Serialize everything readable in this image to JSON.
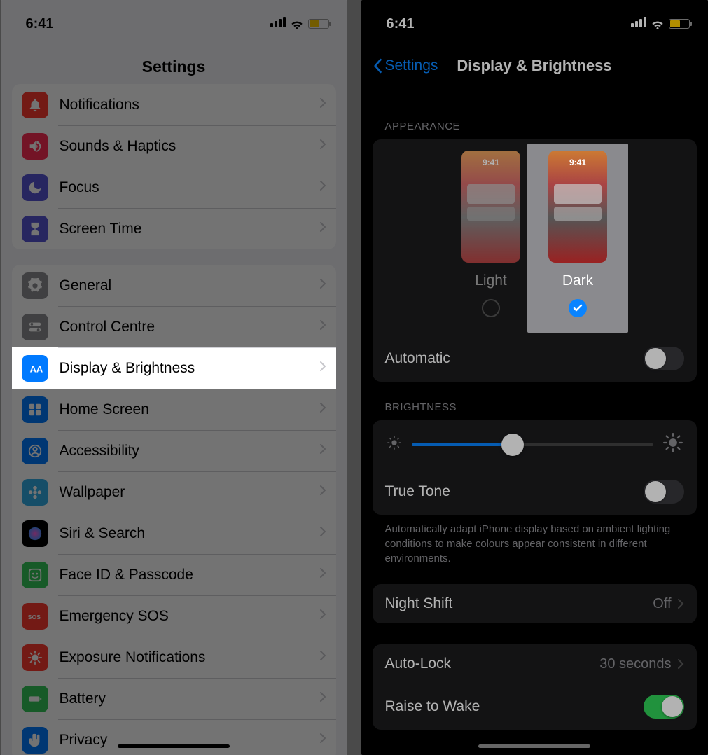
{
  "statusbar": {
    "time": "6:41"
  },
  "left": {
    "title": "Settings",
    "group1": [
      {
        "label": "Notifications",
        "icon": "bell",
        "color": "ic-red"
      },
      {
        "label": "Sounds & Haptics",
        "icon": "speaker",
        "color": "ic-pink"
      },
      {
        "label": "Focus",
        "icon": "moon",
        "color": "ic-indigo"
      },
      {
        "label": "Screen Time",
        "icon": "hourglass",
        "color": "ic-indigo"
      }
    ],
    "group2": [
      {
        "label": "General",
        "icon": "gear",
        "color": "ic-gray"
      },
      {
        "label": "Control Centre",
        "icon": "switches",
        "color": "ic-gray"
      },
      {
        "label": "Display & Brightness",
        "icon": "aa",
        "color": "ic-blue",
        "highlight": true
      },
      {
        "label": "Home Screen",
        "icon": "grid",
        "color": "ic-blue"
      },
      {
        "label": "Accessibility",
        "icon": "person",
        "color": "ic-blue"
      },
      {
        "label": "Wallpaper",
        "icon": "flower",
        "color": "ic-lightblue"
      },
      {
        "label": "Siri & Search",
        "icon": "siri",
        "color": "ic-black"
      },
      {
        "label": "Face ID & Passcode",
        "icon": "face",
        "color": "ic-green"
      },
      {
        "label": "Emergency SOS",
        "icon": "sos",
        "color": "ic-sosred"
      },
      {
        "label": "Exposure Notifications",
        "icon": "covid",
        "color": "ic-covid"
      },
      {
        "label": "Battery",
        "icon": "battery",
        "color": "ic-green"
      },
      {
        "label": "Privacy",
        "icon": "hand",
        "color": "ic-blue"
      }
    ]
  },
  "right": {
    "back": "Settings",
    "title": "Display & Brightness",
    "appearance_header": "APPEARANCE",
    "preview_time": "9:41",
    "light_label": "Light",
    "dark_label": "Dark",
    "automatic_label": "Automatic",
    "automatic_on": false,
    "brightness_header": "BRIGHTNESS",
    "brightness_pct": 42,
    "truetone_label": "True Tone",
    "truetone_on": false,
    "truetone_footnote": "Automatically adapt iPhone display based on ambient lighting conditions to make colours appear consistent in different environments.",
    "nightshift_label": "Night Shift",
    "nightshift_value": "Off",
    "autolock_label": "Auto-Lock",
    "autolock_value": "30 seconds",
    "raise_label": "Raise to Wake",
    "raise_on": true
  }
}
